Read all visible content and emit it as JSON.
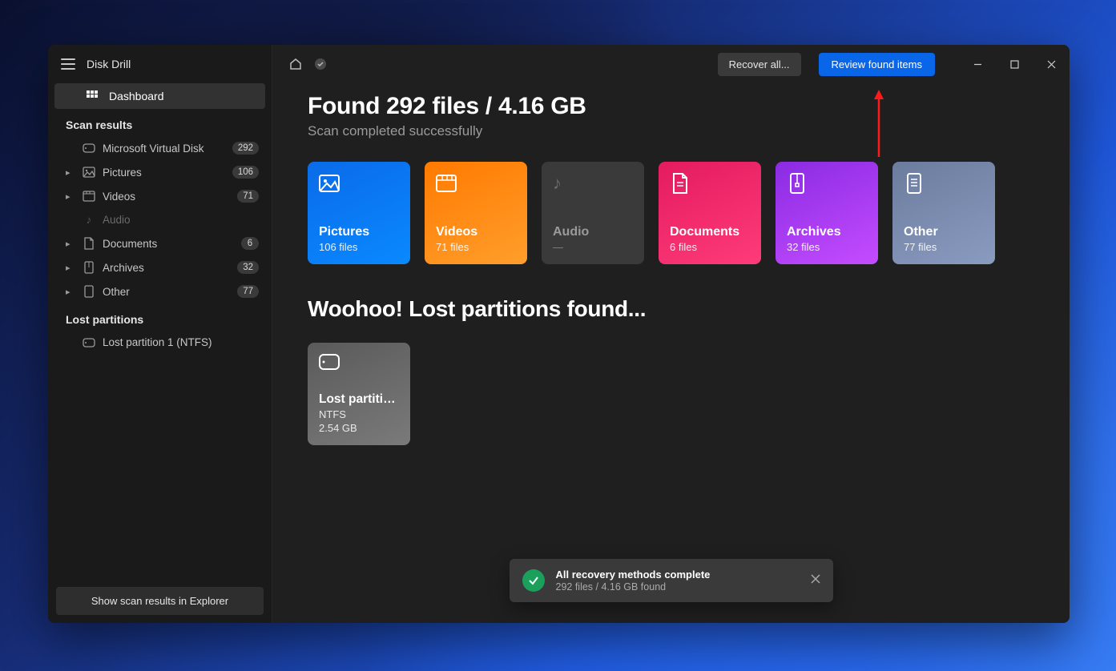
{
  "app": {
    "title": "Disk Drill"
  },
  "nav": {
    "dashboard": "Dashboard"
  },
  "sidebar": {
    "scan_results_heading": "Scan results",
    "lost_partitions_heading": "Lost partitions",
    "items": [
      {
        "label": "Microsoft Virtual Disk",
        "count": "292"
      },
      {
        "label": "Pictures",
        "count": "106"
      },
      {
        "label": "Videos",
        "count": "71"
      },
      {
        "label": "Audio",
        "count": ""
      },
      {
        "label": "Documents",
        "count": "6"
      },
      {
        "label": "Archives",
        "count": "32"
      },
      {
        "label": "Other",
        "count": "77"
      }
    ],
    "lost_partitions": [
      {
        "label": "Lost partition 1 (NTFS)"
      }
    ],
    "footer_button": "Show scan results in Explorer"
  },
  "titlebar": {
    "recover_all": "Recover all...",
    "review": "Review found items"
  },
  "summary": {
    "heading": "Found 292 files / 4.16 GB",
    "sub": "Scan completed successfully"
  },
  "cards": {
    "pictures": {
      "title": "Pictures",
      "sub": "106 files"
    },
    "videos": {
      "title": "Videos",
      "sub": "71 files"
    },
    "audio": {
      "title": "Audio",
      "sub": "—"
    },
    "documents": {
      "title": "Documents",
      "sub": "6 files"
    },
    "archives": {
      "title": "Archives",
      "sub": "32 files"
    },
    "other": {
      "title": "Other",
      "sub": "77 files"
    }
  },
  "partitions": {
    "heading": "Woohoo! Lost partitions found...",
    "items": [
      {
        "title": "Lost partitio...",
        "fs": "NTFS",
        "size": "2.54 GB"
      }
    ]
  },
  "toast": {
    "title": "All recovery methods complete",
    "sub": "292 files / 4.16 GB found"
  }
}
